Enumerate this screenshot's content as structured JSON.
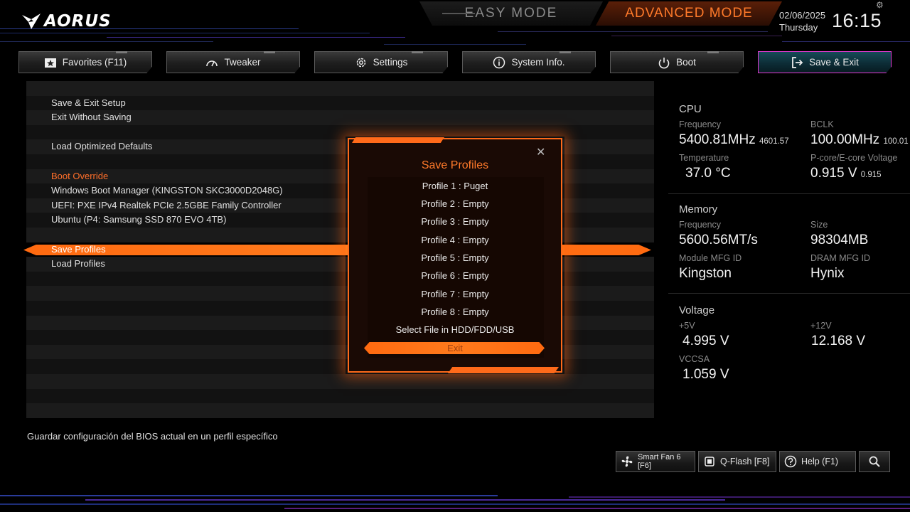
{
  "brand": "AORUS",
  "modes": {
    "easy": "EASY MODE",
    "advanced": "ADVANCED MODE"
  },
  "datetime": {
    "date": "02/06/2025",
    "weekday": "Thursday",
    "time": "16:15"
  },
  "tabs": [
    {
      "label": "Favorites (F11)",
      "icon": "star-icon"
    },
    {
      "label": "Tweaker",
      "icon": "speedometer-icon"
    },
    {
      "label": "Settings",
      "icon": "gear-icon"
    },
    {
      "label": "System Info.",
      "icon": "info-icon"
    },
    {
      "label": "Boot",
      "icon": "power-icon"
    },
    {
      "label": "Save & Exit",
      "icon": "exit-icon",
      "active": true
    }
  ],
  "menu": {
    "save_exit_setup": "Save & Exit Setup",
    "exit_without_saving": "Exit Without Saving",
    "load_optimized_defaults": "Load Optimized Defaults",
    "boot_override": "Boot Override",
    "boot_1": "Windows Boot Manager (KINGSTON SKC3000D2048G)",
    "boot_2": "UEFI: PXE IPv4 Realtek PCIe 2.5GBE Family Controller",
    "boot_3": "Ubuntu (P4: Samsung SSD 870 EVO 4TB)",
    "save_profiles": "Save Profiles",
    "load_profiles": "Load Profiles"
  },
  "dialog": {
    "title": "Save Profiles",
    "items": [
      "Profile 1 : Puget",
      "Profile 2 : Empty",
      "Profile 3 : Empty",
      "Profile 4 : Empty",
      "Profile 5 : Empty",
      "Profile 6 : Empty",
      "Profile 7 : Empty",
      "Profile 8 : Empty",
      "Select File in HDD/FDD/USB"
    ],
    "exit": "Exit",
    "close_symbol": "✕"
  },
  "cpu": {
    "section": "CPU",
    "frequency_label": "Frequency",
    "frequency": "5400.81MHz",
    "frequency_sub": "4601.57",
    "bclk_label": "BCLK",
    "bclk": "100.00MHz",
    "bclk_sub": "100.01",
    "temp_label": "Temperature",
    "temp": "37.0 °C",
    "voltage_label": "P-core/E-core Voltage",
    "voltage": "0.915 V",
    "voltage_sub": "0.915"
  },
  "memory": {
    "section": "Memory",
    "frequency_label": "Frequency",
    "frequency": "5600.56MT/s",
    "size_label": "Size",
    "size": "98304MB",
    "module_label": "Module MFG ID",
    "module": "Kingston",
    "dram_label": "DRAM MFG ID",
    "dram": "Hynix"
  },
  "voltage": {
    "section": "Voltage",
    "v5_label": "+5V",
    "v5": "4.995 V",
    "v12_label": "+12V",
    "v12": "12.168 V",
    "vccsa_label": "VCCSA",
    "vccsa": "1.059 V"
  },
  "help_text": "Guardar configuración del BIOS actual en un perfil específico",
  "bottom_buttons": {
    "smart_fan": "Smart Fan 6 [F6]",
    "qflash": "Q-Flash [F8]",
    "help": "Help (F1)"
  },
  "colors": {
    "accent": "#ff6a1a",
    "active_tab_border": "#e43bd4",
    "section": "#ff6f2a"
  }
}
